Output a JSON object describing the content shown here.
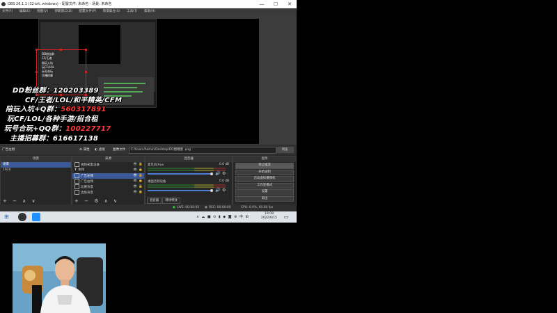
{
  "window": {
    "title": "OBS 26.1.1 (32-bit, windows) - 配置文件: 未命名 - 场景: 未命名",
    "minimize": "—",
    "maximize": "☐",
    "close": "✕"
  },
  "menu": [
    "文件(F)",
    "编辑(E)",
    "视图(V)",
    "停靠窗口(D)",
    "配置文件(P)",
    "场景集合(S)",
    "工具(T)",
    "帮助(H)"
  ],
  "nested_text": [
    "DD粉丝群",
    "CF/王者",
    "陪玩入坑",
    "玩CF/LOL",
    "玩号合玩",
    "主播招募"
  ],
  "overlay": [
    {
      "text": "DD粉丝群：",
      "red": "",
      "after": "120203389"
    },
    {
      "text": "CF/王者/LOL/和平精英/CFM",
      "red": "",
      "after": ""
    },
    {
      "text": "陪玩入坑+Q群：",
      "red": "560317891",
      "after": ""
    },
    {
      "text": "玩CF/LOL/各种手游/招合租",
      "red": "",
      "after": ""
    },
    {
      "text": "玩号合玩+QQ群：",
      "red": "100227717",
      "after": ""
    },
    {
      "text": "主播招募群：",
      "red": "",
      "after": "616617138"
    }
  ],
  "sourcebar": {
    "label": "广告左侧",
    "props": "⚙ 属性",
    "filters": "◐ 滤镜",
    "image_file": "图像文件",
    "path": "C:/Users/Admin/Desktop/DD图端图 .png",
    "browse": "浏览"
  },
  "scenes": {
    "header": "场景",
    "items": [
      "场景",
      "1920"
    ],
    "selected": 0,
    "controls": "+ − ∧ ∨"
  },
  "sources": {
    "header": "来源",
    "items": [
      "视频采集设备",
      "本样",
      "广告左侧",
      "广告右侧",
      "比赛背景",
      "边角背景"
    ],
    "selected": 2,
    "controls": "+ − ⚙ ∧ ∨"
  },
  "mixer": {
    "header": "混音器",
    "channels": [
      {
        "name": "麦克风/Aux",
        "db": "0.0 dB"
      },
      {
        "name": "桌面音频设备",
        "db": "0.0 dB"
      }
    ],
    "tabs": [
      "混音器",
      "转场特效"
    ]
  },
  "controls": {
    "header": "控件",
    "buttons": [
      "停止推流",
      "开始录制",
      "启动虚拟摄像机",
      "工作室模式",
      "设置",
      "退出"
    ]
  },
  "status": {
    "live": "LIVE: 00:00:00",
    "rec": "REC: 00:00:00",
    "cpu": "CPU: 0.9%, 60.00 fps"
  },
  "taskbar": {
    "tray": "∧  ☁  ■  ⊙  ▮  ◆  ◙  ⊛  中  ⊞",
    "time": "19:08",
    "date": "2022/6/15"
  }
}
